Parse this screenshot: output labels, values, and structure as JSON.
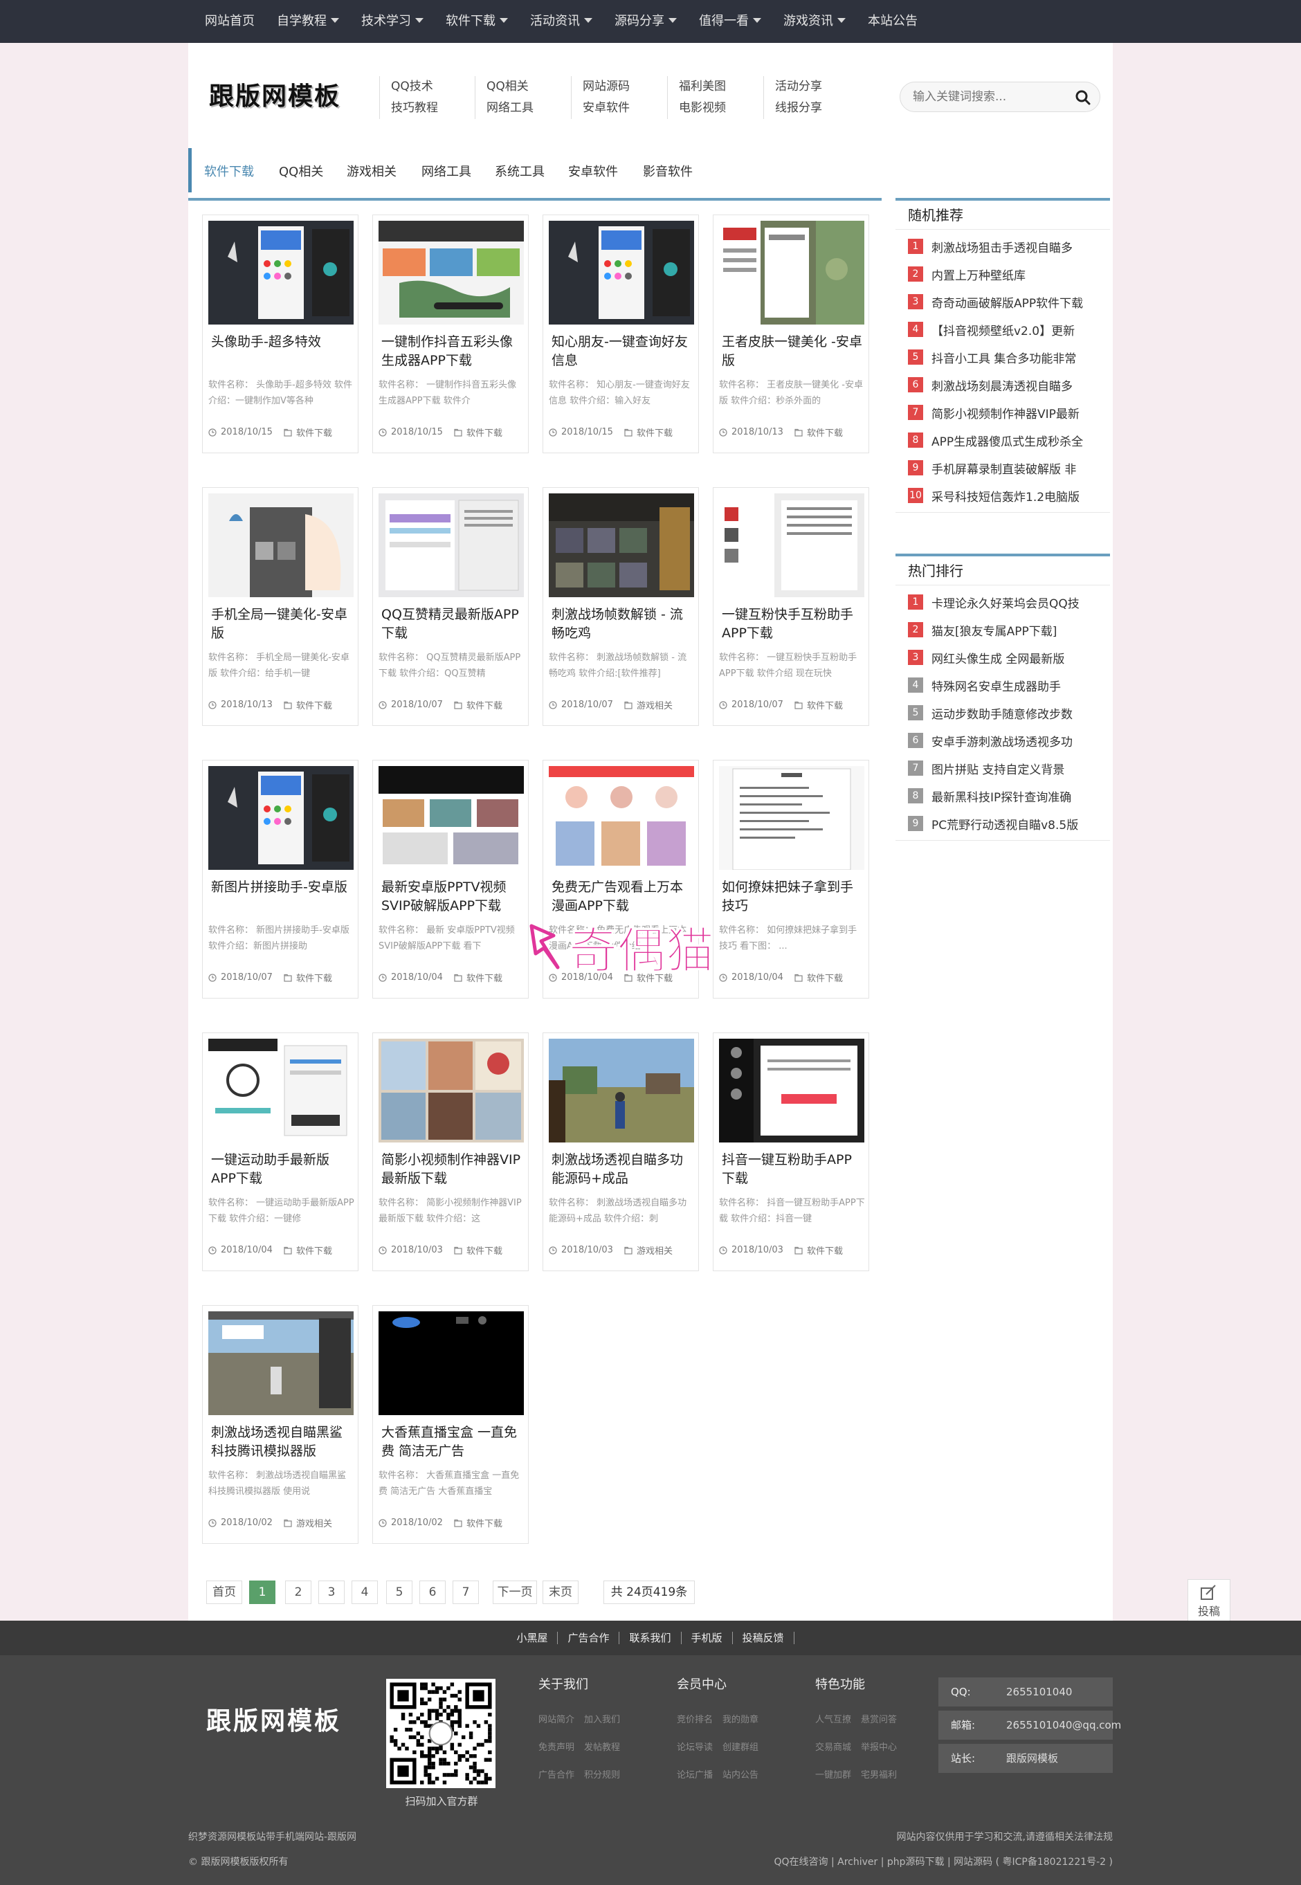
{
  "topnav": {
    "items": [
      {
        "label": "网站首页",
        "dropdown": false
      },
      {
        "label": "自学教程",
        "dropdown": true
      },
      {
        "label": "技术学习",
        "dropdown": true
      },
      {
        "label": "软件下载",
        "dropdown": true
      },
      {
        "label": "活动资讯",
        "dropdown": true
      },
      {
        "label": "源码分享",
        "dropdown": true
      },
      {
        "label": "值得一看",
        "dropdown": true
      },
      {
        "label": "游戏资讯",
        "dropdown": true
      },
      {
        "label": "本站公告",
        "dropdown": false
      }
    ]
  },
  "header": {
    "logo": "跟版网模板",
    "links": [
      [
        "QQ技术",
        "技巧教程"
      ],
      [
        "QQ相关",
        "网络工具"
      ],
      [
        "网站源码",
        "安卓软件"
      ],
      [
        "福利美图",
        "电影视频"
      ],
      [
        "活动分享",
        "线报分享"
      ]
    ],
    "search_placeholder": "输入关键词搜索..."
  },
  "categories": [
    "软件下载",
    "QQ相关",
    "游戏相关",
    "网络工具",
    "系统工具",
    "安卓软件",
    "影音软件"
  ],
  "articles": [
    {
      "title": "头像助手-超多特效",
      "desc": "软件名称： 头像助手-超多特效 软件介绍：一键制作加V等各种",
      "date": "2018/10/15",
      "category": "软件下载",
      "thumb": "phone-dark"
    },
    {
      "title": "一键制作抖音五彩头像生成器APP下载",
      "desc": "软件名称： 一键制作抖音五彩头像生成器APP下载 软件介",
      "date": "2018/10/15",
      "category": "软件下载",
      "thumb": "app-map"
    },
    {
      "title": "知心朋友-一键查询好友信息",
      "desc": "软件名称： 知心朋友-一键查询好友信息 软件介绍：输入好友",
      "date": "2018/10/15",
      "category": "软件下载",
      "thumb": "phone-dark"
    },
    {
      "title": "王者皮肤一键美化 -安卓版",
      "desc": "软件名称： 王者皮肤一键美化 -安卓版 软件介绍：秒杀外面的",
      "date": "2018/10/13",
      "category": "软件下载",
      "thumb": "game-map"
    },
    {
      "title": "手机全局一键美化-安卓版",
      "desc": "软件名称： 手机全局一键美化-安卓版 软件介绍：给手机一键",
      "date": "2018/10/13",
      "category": "软件下载",
      "thumb": "anime"
    },
    {
      "title": "QQ互赞精灵最新版APP下载",
      "desc": "软件名称： QQ互赞精灵最新版APP下载 软件介绍：QQ互赞精",
      "date": "2018/10/07",
      "category": "软件下载",
      "thumb": "desktop"
    },
    {
      "title": "刺激战场帧数解锁 - 流畅吃鸡",
      "desc": "软件名称： 刺激战场帧数解锁 - 流畅吃鸡 软件介绍:[软件推荐]",
      "date": "2018/10/07",
      "category": "游戏相关",
      "thumb": "game-menu"
    },
    {
      "title": "一键互粉快手互粉助手APP下载",
      "desc": "软件名称： 一键互粉快手互粉助手APP下载 软件介绍 现在玩快",
      "date": "2018/10/07",
      "category": "软件下载",
      "thumb": "desktop-list"
    },
    {
      "title": "新图片拼接助手-安卓版",
      "desc": "软件名称： 新图片拼接助手-安卓版 软件介绍：新图片拼接助",
      "date": "2018/10/07",
      "category": "软件下载",
      "thumb": "phone-dark"
    },
    {
      "title": "最新安卓版PPTV视频SVIP破解版APP下载",
      "desc": "软件名称： 最新 安卓版PPTV视频SVIP破解版APP下载 看下",
      "date": "2018/10/04",
      "category": "软件下载",
      "thumb": "video-app"
    },
    {
      "title": "免费无广告观看上万本漫画APP下载",
      "desc": "软件名称： 免费无广告观看上万本漫画APP下载 软件介绍",
      "date": "2018/10/04",
      "category": "软件下载",
      "thumb": "comic"
    },
    {
      "title": "如何撩妹把妹子拿到手技巧",
      "desc": "软件名称： 如何撩妹把妹子拿到手技巧 看下图： ...",
      "date": "2018/10/04",
      "category": "软件下载",
      "thumb": "doc"
    },
    {
      "title": "一键运动助手最新版APP下载",
      "desc": "软件名称： 一键运动助手最新版APP下载 软件介绍：一键修",
      "date": "2018/10/04",
      "category": "软件下载",
      "thumb": "sport"
    },
    {
      "title": "简影小视频制作神器VIP最新版下载",
      "desc": "软件名称： 简影小视频制作神器VIP最新版下载 软件介绍：这",
      "date": "2018/10/03",
      "category": "软件下载",
      "thumb": "collage"
    },
    {
      "title": "刺激战场透视自瞄多功能源码+成品",
      "desc": "软件名称： 刺激战场透视自瞄多功能源码+成品 软件介绍：刺",
      "date": "2018/10/03",
      "category": "游戏相关",
      "thumb": "battlefield"
    },
    {
      "title": "抖音一键互粉助手APP下载",
      "desc": "软件名称： 抖音一键互粉助手APP下载 软件介绍：抖音一键",
      "date": "2018/10/03",
      "category": "软件下载",
      "thumb": "dark-app"
    },
    {
      "title": "刺激战场透视自瞄黑鲨科技腾讯模拟器版",
      "desc": "软件名称： 刺激战场透视自瞄黑鲨科技腾讯模拟器版 使用说",
      "date": "2018/10/02",
      "category": "游戏相关",
      "thumb": "battlefield2"
    },
    {
      "title": "大香蕉直播宝盒 一直免费 简洁无广告",
      "desc": "软件名称： 大香蕉直播宝盒 一直免费 简洁无广告 大香蕉直播宝",
      "date": "2018/10/02",
      "category": "软件下载",
      "thumb": "black"
    }
  ],
  "pagination": {
    "items": [
      "首页",
      "1",
      "2",
      "3",
      "4",
      "5",
      "6",
      "7",
      "下一页",
      "末页"
    ],
    "current": "1",
    "total": "共 24页419条"
  },
  "sidebar": {
    "random": {
      "title": "随机推荐",
      "items": [
        "刺激战场狙击手透视自瞄多",
        "内置上万种壁纸库",
        "奇奇动画破解版APP软件下载",
        "【抖音视频壁纸v2.0】更新",
        "抖音小工具 集合多功能非常",
        "刺激战场刻晨涛透视自瞄多",
        "简影小视频制作神器VIP最新",
        "APP生成器傻瓜式生成秒杀全",
        "手机屏幕录制直装破解版 非",
        "采号科技短信轰炸1.2电脑版"
      ]
    },
    "hot": {
      "title": "热门排行",
      "items": [
        "卡理论永久好莱坞会员QQ技",
        "猫友[狼友专属APP下载]",
        "网红头像生成 全网最新版",
        "特殊网名安卓生成器助手",
        "运动步数助手随意修改步数",
        "安卓手游刺激战场透视多功",
        "图片拼贴 支持自定义背景",
        "最新黑科技IP探针查询准确",
        "PC荒野行动透视自瞄v8.5版"
      ]
    }
  },
  "footer": {
    "links": [
      "小黑屋",
      "广告合作",
      "联系我们",
      "手机版",
      "投稿反馈"
    ],
    "logo": "跟版网模板",
    "qr_caption": "扫码加入官方群",
    "columns": [
      {
        "title": "关于我们",
        "rows": [
          [
            "网站简介",
            "加入我们"
          ],
          [
            "免责声明",
            "发帖教程"
          ],
          [
            "广告合作",
            "积分规则"
          ]
        ]
      },
      {
        "title": "会员中心",
        "rows": [
          [
            "竞价排名",
            "我的勋章"
          ],
          [
            "论坛导读",
            "创建群组"
          ],
          [
            "论坛广播",
            "站内公告"
          ]
        ]
      },
      {
        "title": "特色功能",
        "rows": [
          [
            "人气互撩",
            "悬赏问答"
          ],
          [
            "交易商城",
            "举报中心"
          ],
          [
            "一键加群",
            "宅男福利"
          ]
        ]
      }
    ],
    "contacts": [
      {
        "label": "QQ:",
        "value": "2655101040"
      },
      {
        "label": "邮箱:",
        "value": "2655101040@qq.com"
      },
      {
        "label": "站长:",
        "value": "跟版网模板"
      }
    ],
    "bottom_left_1": "织梦资源网模板站带手机端网站-跟版网",
    "bottom_left_2": "© 跟版网模板版权所有",
    "bottom_right_1": "网站内容仅供用于学习和交流,请遵循相关法律法规",
    "bottom_right_2": "QQ在线咨询 | Archiver | php源码下载 | 网站源码 ( 粤ICP备18021221号-2 )"
  },
  "tougao_label": "投稿",
  "watermark": "奇偶猫",
  "colors": {
    "topnav": "#2e323d",
    "accent": "#4a88b0",
    "current_page": "#5aa06a",
    "rank_top": "#e14848",
    "rank_rest": "#999999",
    "footer": "#474747"
  }
}
